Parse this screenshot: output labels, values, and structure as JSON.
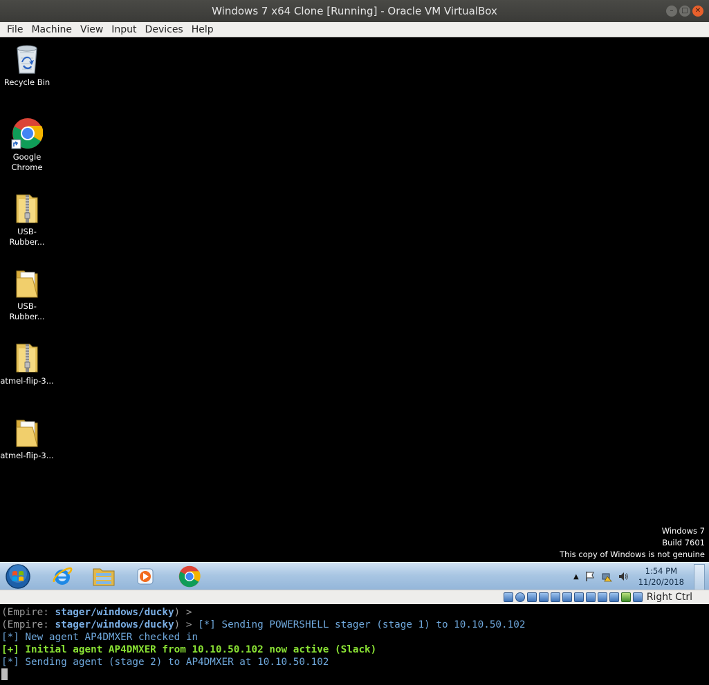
{
  "window": {
    "title": "Windows 7 x64 Clone [Running] - Oracle VM VirtualBox"
  },
  "menubar": [
    "File",
    "Machine",
    "View",
    "Input",
    "Devices",
    "Help"
  ],
  "desktop_icons": [
    {
      "label": "Recycle Bin",
      "icon": "recycle-bin-icon"
    },
    {
      "label": "Google Chrome",
      "icon": "chrome-icon"
    },
    {
      "label": "USB-Rubber...",
      "icon": "zip-folder-icon"
    },
    {
      "label": "USB-Rubber...",
      "icon": "folder-icon"
    },
    {
      "label": "atmel-flip-3...",
      "icon": "zip-folder-icon"
    },
    {
      "label": "atmel-flip-3...",
      "icon": "folder-icon"
    }
  ],
  "watermark": {
    "line1": "Windows 7",
    "line2": "Build 7601",
    "line3": "This copy of Windows is not genuine"
  },
  "taskbar": {
    "clock_time": "1:54 PM",
    "clock_date": "11/20/2018"
  },
  "vbox_status": {
    "host_key": "Right Ctrl"
  },
  "terminal": {
    "line1_prompt": "(Empire: ",
    "line1_module": "stager/windows/ducky",
    "line1_tail": ") >",
    "line2_prompt": "(Empire: ",
    "line2_module": "stager/windows/ducky",
    "line2_tail": ") > ",
    "line2_msg": "[*] Sending POWERSHELL stager (stage 1) to 10.10.50.102",
    "line3": "[*] New agent AP4DMXER checked in",
    "line4": "[+] Initial agent AP4DMXER from 10.10.50.102 now active (Slack)",
    "line5": "[*] Sending agent (stage 2) to AP4DMXER at 10.10.50.102"
  }
}
